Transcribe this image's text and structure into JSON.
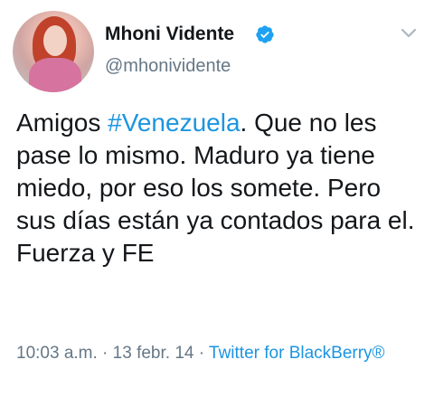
{
  "author": {
    "name": "Mhoni Vidente",
    "handle": "@mhonividente",
    "verified": true
  },
  "icons": {
    "verified": "verified-badge-icon",
    "menu": "chevron-down-icon"
  },
  "tweet": {
    "text_before": "Amigos ",
    "hashtag": "#Venezuela",
    "text_after": ". Que no les pase lo mismo. Maduro ya tiene miedo, por eso los somete. Pero sus días están ya contados para el. Fuerza y FE"
  },
  "meta": {
    "time": "10:03 a.m.",
    "separator": " · ",
    "date": "13 febr. 14",
    "source": "Twitter for BlackBerry®"
  },
  "colors": {
    "link": "#1b95e0",
    "secondary_text": "#657786",
    "primary_text": "#14171a"
  }
}
